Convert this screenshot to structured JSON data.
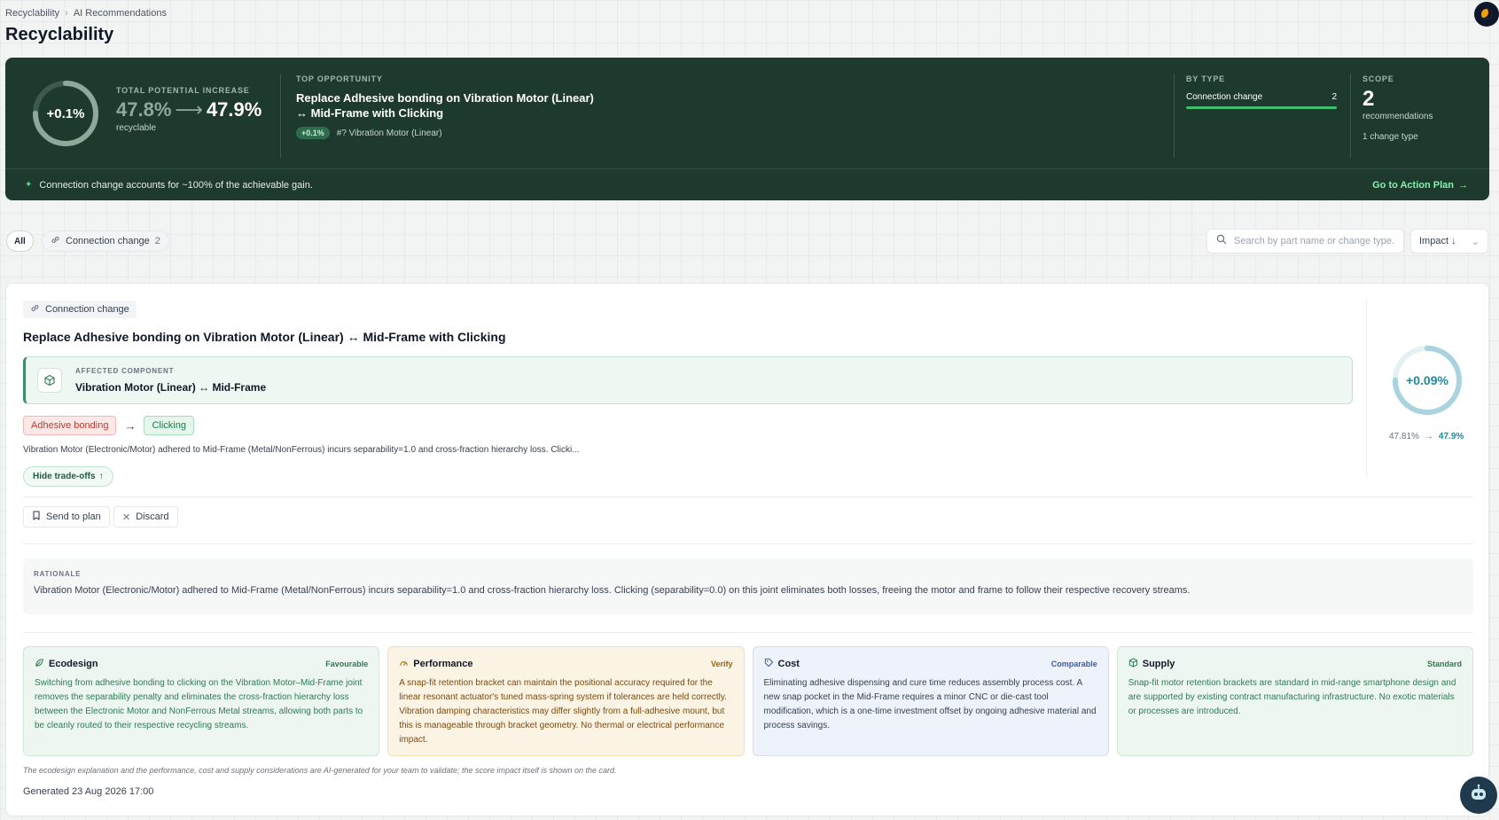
{
  "breadcrumb": {
    "root": "Recyclability",
    "current": "AI Recommendations"
  },
  "page_title": "Recyclability",
  "summary": {
    "ring_value": "+0.1%",
    "ring_fraction": 0.75,
    "total_label": "TOTAL POTENTIAL INCREASE",
    "from": "47.8%",
    "to": "47.9%",
    "unit_label": "recyclable",
    "top_label": "TOP OPPORTUNITY",
    "top_title_1": "Replace Adhesive bonding on Vibration Motor (Linear)",
    "top_title_2": "↔ Mid-Frame with Clicking",
    "top_badge": "+0.1%",
    "top_part": "#? Vibration Motor (Linear)",
    "bytype_label": "BY TYPE",
    "bytype_name": "Connection change",
    "bytype_count": "2",
    "bytype_fraction": 1.0,
    "scope_label": "SCOPE",
    "scope_count": "2",
    "scope_sub": "recommendations",
    "scope_sub2": "1 change type",
    "footer_text": "Connection change accounts for ~100% of the achievable gain.",
    "footer_link": "Go to Action Plan"
  },
  "filters": {
    "all": "All",
    "connection_label": "Connection change",
    "connection_count": "2",
    "search_placeholder": "Search by part name or change type...",
    "sort_label": "Impact"
  },
  "card": {
    "type_chip": "Connection change",
    "title": "Replace Adhesive bonding on Vibration Motor (Linear) ↔ Mid-Frame with Clicking",
    "affected_label": "AFFECTED COMPONENT",
    "affected_name": "Vibration Motor (Linear) ↔ Mid-Frame",
    "from_tag": "Adhesive bonding",
    "to_tag": "Clicking",
    "description": "Vibration Motor (Electronic/Motor) adhered to Mid-Frame (Metal/NonFerrous) incurs separability=1.0 and cross-fraction hierarchy loss. Clicki...",
    "tradeoffs_btn": "Hide trade-offs",
    "score_value": "+0.09%",
    "score_fraction": 0.75,
    "score_from": "47.81%",
    "score_to": "47.9%",
    "send_btn": "Send to plan",
    "discard_btn": "Discard",
    "rationale_label": "RATIONALE",
    "rationale_text": "Vibration Motor (Electronic/Motor) adhered to Mid-Frame (Metal/NonFerrous) incurs separability=1.0 and cross-fraction hierarchy loss. Clicking (separability=0.0) on this joint eliminates both losses, freeing the motor and frame to follow their respective recovery streams.",
    "tiles": [
      {
        "name": "Ecodesign",
        "verdict": "Favourable",
        "body": "Switching from adhesive bonding to clicking on the Vibration Motor–Mid-Frame joint removes the separability penalty and eliminates the cross-fraction hierarchy loss between the Electronic Motor and NonFerrous Metal streams, allowing both parts to be cleanly routed to their respective recycling streams."
      },
      {
        "name": "Performance",
        "verdict": "Verify",
        "body": "A snap-fit retention bracket can maintain the positional accuracy required for the linear resonant actuator's tuned mass-spring system if tolerances are held correctly. Vibration damping characteristics may differ slightly from a full-adhesive mount, but this is manageable through bracket geometry. No thermal or electrical performance impact."
      },
      {
        "name": "Cost",
        "verdict": "Comparable",
        "body": "Eliminating adhesive dispensing and cure time reduces assembly process cost. A new snap pocket in the Mid-Frame requires a minor CNC or die-cast tool modification, which is a one-time investment offset by ongoing adhesive material and process savings."
      },
      {
        "name": "Supply",
        "verdict": "Standard",
        "body": "Snap-fit motor retention brackets are standard in mid-range smartphone design and are supported by existing contract manufacturing infrastructure. No exotic materials or processes are introduced."
      }
    ],
    "disclaimer": "The ecodesign explanation and the performance, cost and supply considerations are AI-generated for your team to validate; the score impact itself is shown on the card.",
    "generated": "Generated 23 Aug 2026 17:00"
  },
  "colors": {
    "hero_bg": "#1e3a2e",
    "accent_green": "#4ade80",
    "score_teal": "#1e8aa0"
  }
}
